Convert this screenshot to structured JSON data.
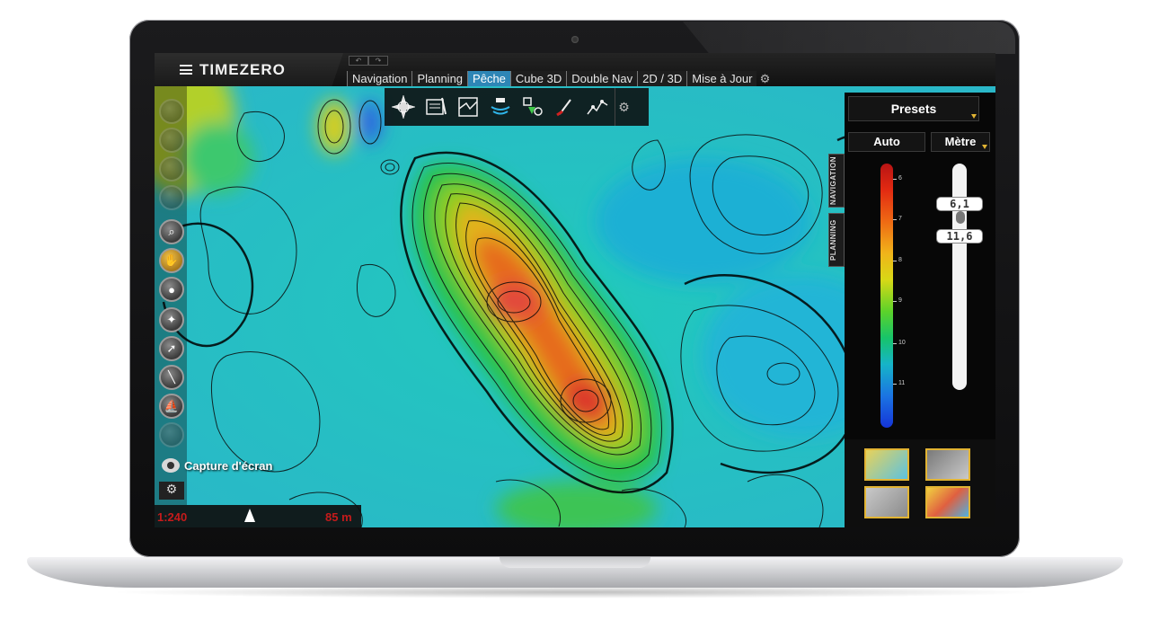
{
  "app": {
    "brand": "TIMEZERO",
    "tabs": [
      {
        "label": "Navigation",
        "active": false
      },
      {
        "label": "Planning",
        "active": false
      },
      {
        "label": "Pêche",
        "active": true
      },
      {
        "label": "Cube 3D",
        "active": false
      },
      {
        "label": "Double Nav",
        "active": false
      },
      {
        "label": "2D / 3D",
        "active": false
      },
      {
        "label": "Mise à Jour",
        "active": false
      }
    ],
    "accent_color": "#2e86b6"
  },
  "fishing_toolbar": {
    "icons": [
      "compass-rose-icon",
      "logbook-icon",
      "chart-overlay-icon",
      "sounder-icon",
      "target-icon",
      "pen-icon",
      "contour-icon",
      "settings-icon"
    ]
  },
  "left_toolbar": {
    "icons": [
      "brightness-icon",
      "brightness-icon",
      "brightness-icon",
      "brightness-icon",
      "zoom-icon",
      "pan-hand-icon",
      "center-icon",
      "waypoint-icon",
      "route-icon",
      "ruler-icon",
      "boat-icon"
    ],
    "capture_label": "Capture d'écran"
  },
  "status_bar": {
    "scale": "1:240",
    "distance": "85 m"
  },
  "side_tabs": [
    "NAVIGATION",
    "PLANNING"
  ],
  "right_panel": {
    "presets_label": "Presets",
    "mode_label": "Auto",
    "unit_label": "Mètre",
    "depth_ticks": [
      "6",
      "7",
      "8",
      "9",
      "10",
      "11"
    ],
    "range_min": "6,1",
    "range_max": "11,6"
  }
}
